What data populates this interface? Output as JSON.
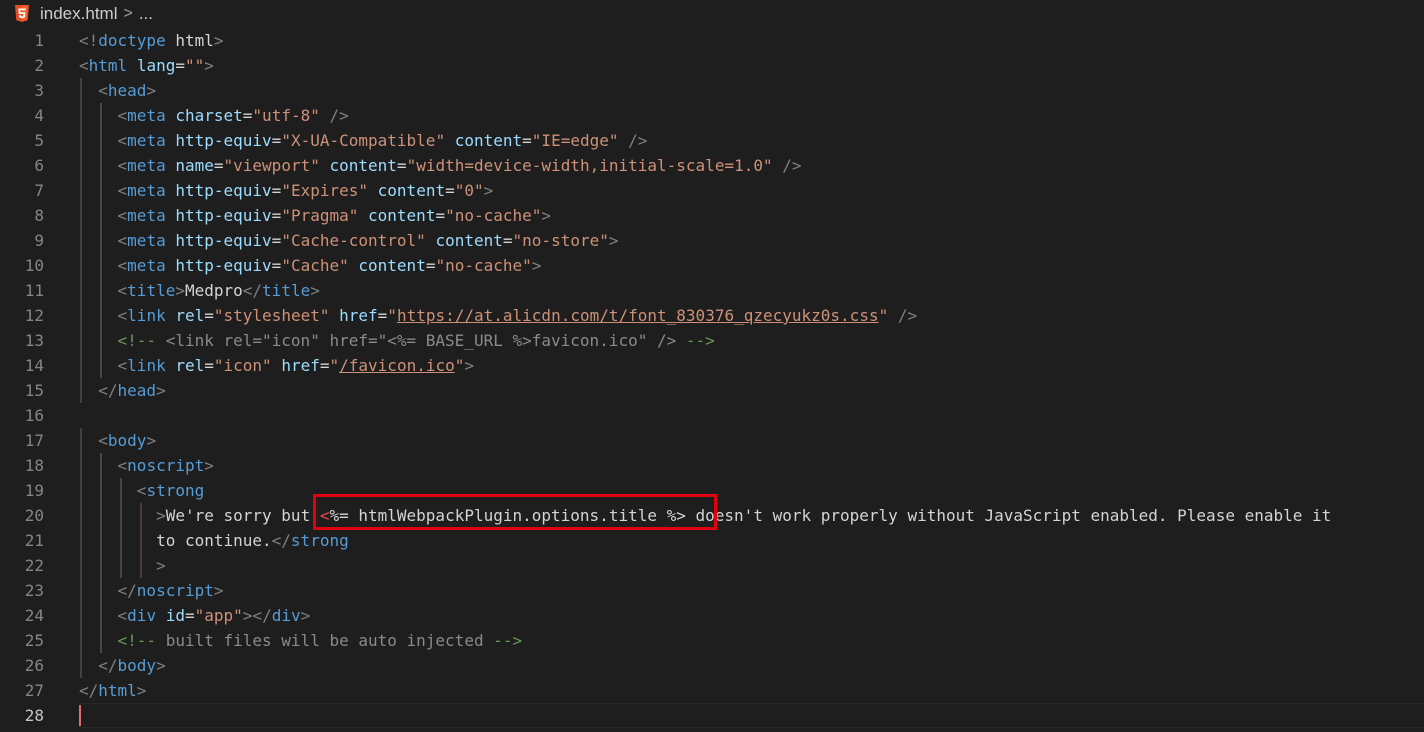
{
  "breadcrumb": {
    "file": "index.html",
    "separator": ">",
    "more": "..."
  },
  "editor": {
    "active_line": "28",
    "lines": [
      {
        "n": "1",
        "tokens": [
          [
            "p",
            "<!"
          ],
          [
            "tag",
            "doctype"
          ],
          [
            "text",
            " html"
          ],
          [
            "p",
            ">"
          ]
        ]
      },
      {
        "n": "2",
        "tokens": [
          [
            "p",
            "<"
          ],
          [
            "tag",
            "html"
          ],
          [
            "text",
            " "
          ],
          [
            "attr",
            "lang"
          ],
          [
            "eq",
            "="
          ],
          [
            "str",
            "\"\""
          ],
          [
            "p",
            ">"
          ]
        ]
      },
      {
        "n": "3",
        "tokens": [
          [
            "text",
            "  "
          ],
          [
            "p",
            "<"
          ],
          [
            "tag",
            "head"
          ],
          [
            "p",
            ">"
          ]
        ]
      },
      {
        "n": "4",
        "tokens": [
          [
            "text",
            "    "
          ],
          [
            "p",
            "<"
          ],
          [
            "tag",
            "meta"
          ],
          [
            "text",
            " "
          ],
          [
            "attr",
            "charset"
          ],
          [
            "eq",
            "="
          ],
          [
            "str",
            "\"utf-8\""
          ],
          [
            "text",
            " "
          ],
          [
            "p",
            "/>"
          ]
        ]
      },
      {
        "n": "5",
        "tokens": [
          [
            "text",
            "    "
          ],
          [
            "p",
            "<"
          ],
          [
            "tag",
            "meta"
          ],
          [
            "text",
            " "
          ],
          [
            "attr",
            "http-equiv"
          ],
          [
            "eq",
            "="
          ],
          [
            "str",
            "\"X-UA-Compatible\""
          ],
          [
            "text",
            " "
          ],
          [
            "attr",
            "content"
          ],
          [
            "eq",
            "="
          ],
          [
            "str",
            "\"IE=edge\""
          ],
          [
            "text",
            " "
          ],
          [
            "p",
            "/>"
          ]
        ]
      },
      {
        "n": "6",
        "tokens": [
          [
            "text",
            "    "
          ],
          [
            "p",
            "<"
          ],
          [
            "tag",
            "meta"
          ],
          [
            "text",
            " "
          ],
          [
            "attr",
            "name"
          ],
          [
            "eq",
            "="
          ],
          [
            "str",
            "\"viewport\""
          ],
          [
            "text",
            " "
          ],
          [
            "attr",
            "content"
          ],
          [
            "eq",
            "="
          ],
          [
            "str",
            "\"width=device-width,initial-scale=1.0\""
          ],
          [
            "text",
            " "
          ],
          [
            "p",
            "/>"
          ]
        ]
      },
      {
        "n": "7",
        "tokens": [
          [
            "text",
            "    "
          ],
          [
            "p",
            "<"
          ],
          [
            "tag",
            "meta"
          ],
          [
            "text",
            " "
          ],
          [
            "attr",
            "http-equiv"
          ],
          [
            "eq",
            "="
          ],
          [
            "str",
            "\"Expires\""
          ],
          [
            "text",
            " "
          ],
          [
            "attr",
            "content"
          ],
          [
            "eq",
            "="
          ],
          [
            "str",
            "\"0\""
          ],
          [
            "p",
            ">"
          ]
        ]
      },
      {
        "n": "8",
        "tokens": [
          [
            "text",
            "    "
          ],
          [
            "p",
            "<"
          ],
          [
            "tag",
            "meta"
          ],
          [
            "text",
            " "
          ],
          [
            "attr",
            "http-equiv"
          ],
          [
            "eq",
            "="
          ],
          [
            "str",
            "\"Pragma\""
          ],
          [
            "text",
            " "
          ],
          [
            "attr",
            "content"
          ],
          [
            "eq",
            "="
          ],
          [
            "str",
            "\"no-cache\""
          ],
          [
            "p",
            ">"
          ]
        ]
      },
      {
        "n": "9",
        "tokens": [
          [
            "text",
            "    "
          ],
          [
            "p",
            "<"
          ],
          [
            "tag",
            "meta"
          ],
          [
            "text",
            " "
          ],
          [
            "attr",
            "http-equiv"
          ],
          [
            "eq",
            "="
          ],
          [
            "str",
            "\"Cache-control\""
          ],
          [
            "text",
            " "
          ],
          [
            "attr",
            "content"
          ],
          [
            "eq",
            "="
          ],
          [
            "str",
            "\"no-store\""
          ],
          [
            "p",
            ">"
          ]
        ]
      },
      {
        "n": "10",
        "tokens": [
          [
            "text",
            "    "
          ],
          [
            "p",
            "<"
          ],
          [
            "tag",
            "meta"
          ],
          [
            "text",
            " "
          ],
          [
            "attr",
            "http-equiv"
          ],
          [
            "eq",
            "="
          ],
          [
            "str",
            "\"Cache\""
          ],
          [
            "text",
            " "
          ],
          [
            "attr",
            "content"
          ],
          [
            "eq",
            "="
          ],
          [
            "str",
            "\"no-cache\""
          ],
          [
            "p",
            ">"
          ]
        ]
      },
      {
        "n": "11",
        "tokens": [
          [
            "text",
            "    "
          ],
          [
            "p",
            "<"
          ],
          [
            "tag",
            "title"
          ],
          [
            "p",
            ">"
          ],
          [
            "text",
            "Medpro"
          ],
          [
            "p",
            "</"
          ],
          [
            "tag",
            "title"
          ],
          [
            "p",
            ">"
          ]
        ]
      },
      {
        "n": "12",
        "tokens": [
          [
            "text",
            "    "
          ],
          [
            "p",
            "<"
          ],
          [
            "tag",
            "link"
          ],
          [
            "text",
            " "
          ],
          [
            "attr",
            "rel"
          ],
          [
            "eq",
            "="
          ],
          [
            "str",
            "\"stylesheet\""
          ],
          [
            "text",
            " "
          ],
          [
            "attr",
            "href"
          ],
          [
            "eq",
            "="
          ],
          [
            "str",
            "\""
          ],
          [
            "link",
            "https://at.alicdn.com/t/font_830376_qzecyukz0s.css"
          ],
          [
            "str",
            "\""
          ],
          [
            "text",
            " "
          ],
          [
            "p",
            "/>"
          ]
        ]
      },
      {
        "n": "13",
        "tokens": [
          [
            "text",
            "    "
          ],
          [
            "com",
            "<!--"
          ],
          [
            "comdim",
            " <link rel=\"icon\" href=\"<%= BASE_URL %>favicon.ico\" /> "
          ],
          [
            "com",
            "-->"
          ]
        ]
      },
      {
        "n": "14",
        "tokens": [
          [
            "text",
            "    "
          ],
          [
            "p",
            "<"
          ],
          [
            "tag",
            "link"
          ],
          [
            "text",
            " "
          ],
          [
            "attr",
            "rel"
          ],
          [
            "eq",
            "="
          ],
          [
            "str",
            "\"icon\""
          ],
          [
            "text",
            " "
          ],
          [
            "attr",
            "href"
          ],
          [
            "eq",
            "="
          ],
          [
            "str",
            "\""
          ],
          [
            "link",
            "/favicon.ico"
          ],
          [
            "str",
            "\""
          ],
          [
            "p",
            ">"
          ]
        ]
      },
      {
        "n": "15",
        "tokens": [
          [
            "text",
            "  "
          ],
          [
            "p",
            "</"
          ],
          [
            "tag",
            "head"
          ],
          [
            "p",
            ">"
          ]
        ]
      },
      {
        "n": "16",
        "tokens": []
      },
      {
        "n": "17",
        "tokens": [
          [
            "text",
            "  "
          ],
          [
            "p",
            "<"
          ],
          [
            "tag",
            "body"
          ],
          [
            "p",
            ">"
          ]
        ]
      },
      {
        "n": "18",
        "tokens": [
          [
            "text",
            "    "
          ],
          [
            "p",
            "<"
          ],
          [
            "tag",
            "noscript"
          ],
          [
            "p",
            ">"
          ]
        ]
      },
      {
        "n": "19",
        "tokens": [
          [
            "text",
            "      "
          ],
          [
            "p",
            "<"
          ],
          [
            "tag",
            "strong"
          ]
        ]
      },
      {
        "n": "20",
        "tokens": [
          [
            "text",
            "        "
          ],
          [
            "p",
            ">"
          ],
          [
            "text",
            "We're sorry but "
          ],
          [
            "red",
            "<"
          ],
          [
            "text",
            "%= htmlWebpackPlugin.options.title %> doesn't work properly without JavaScript enabled. Please enable it"
          ]
        ]
      },
      {
        "n": "21",
        "tokens": [
          [
            "text",
            "        to continue."
          ],
          [
            "p",
            "</"
          ],
          [
            "tag",
            "strong"
          ]
        ]
      },
      {
        "n": "22",
        "tokens": [
          [
            "text",
            "        "
          ],
          [
            "p",
            ">"
          ]
        ]
      },
      {
        "n": "23",
        "tokens": [
          [
            "text",
            "    "
          ],
          [
            "p",
            "</"
          ],
          [
            "tag",
            "noscript"
          ],
          [
            "p",
            ">"
          ]
        ]
      },
      {
        "n": "24",
        "tokens": [
          [
            "text",
            "    "
          ],
          [
            "p",
            "<"
          ],
          [
            "tag",
            "div"
          ],
          [
            "text",
            " "
          ],
          [
            "attr",
            "id"
          ],
          [
            "eq",
            "="
          ],
          [
            "str",
            "\"app\""
          ],
          [
            "p",
            "></"
          ],
          [
            "tag",
            "div"
          ],
          [
            "p",
            ">"
          ]
        ]
      },
      {
        "n": "25",
        "tokens": [
          [
            "text",
            "    "
          ],
          [
            "com",
            "<!--"
          ],
          [
            "comdim",
            " built files will be auto injected "
          ],
          [
            "com",
            "-->"
          ]
        ]
      },
      {
        "n": "26",
        "tokens": [
          [
            "text",
            "  "
          ],
          [
            "p",
            "</"
          ],
          [
            "tag",
            "body"
          ],
          [
            "p",
            ">"
          ]
        ]
      },
      {
        "n": "27",
        "tokens": [
          [
            "p",
            "</"
          ],
          [
            "tag",
            "html"
          ],
          [
            "p",
            ">"
          ]
        ]
      },
      {
        "n": "28",
        "tokens": []
      }
    ]
  },
  "colors": {
    "background": "#1e1e1e",
    "html5_icon": "#e44d26",
    "highlight_box": "#e0000f"
  }
}
